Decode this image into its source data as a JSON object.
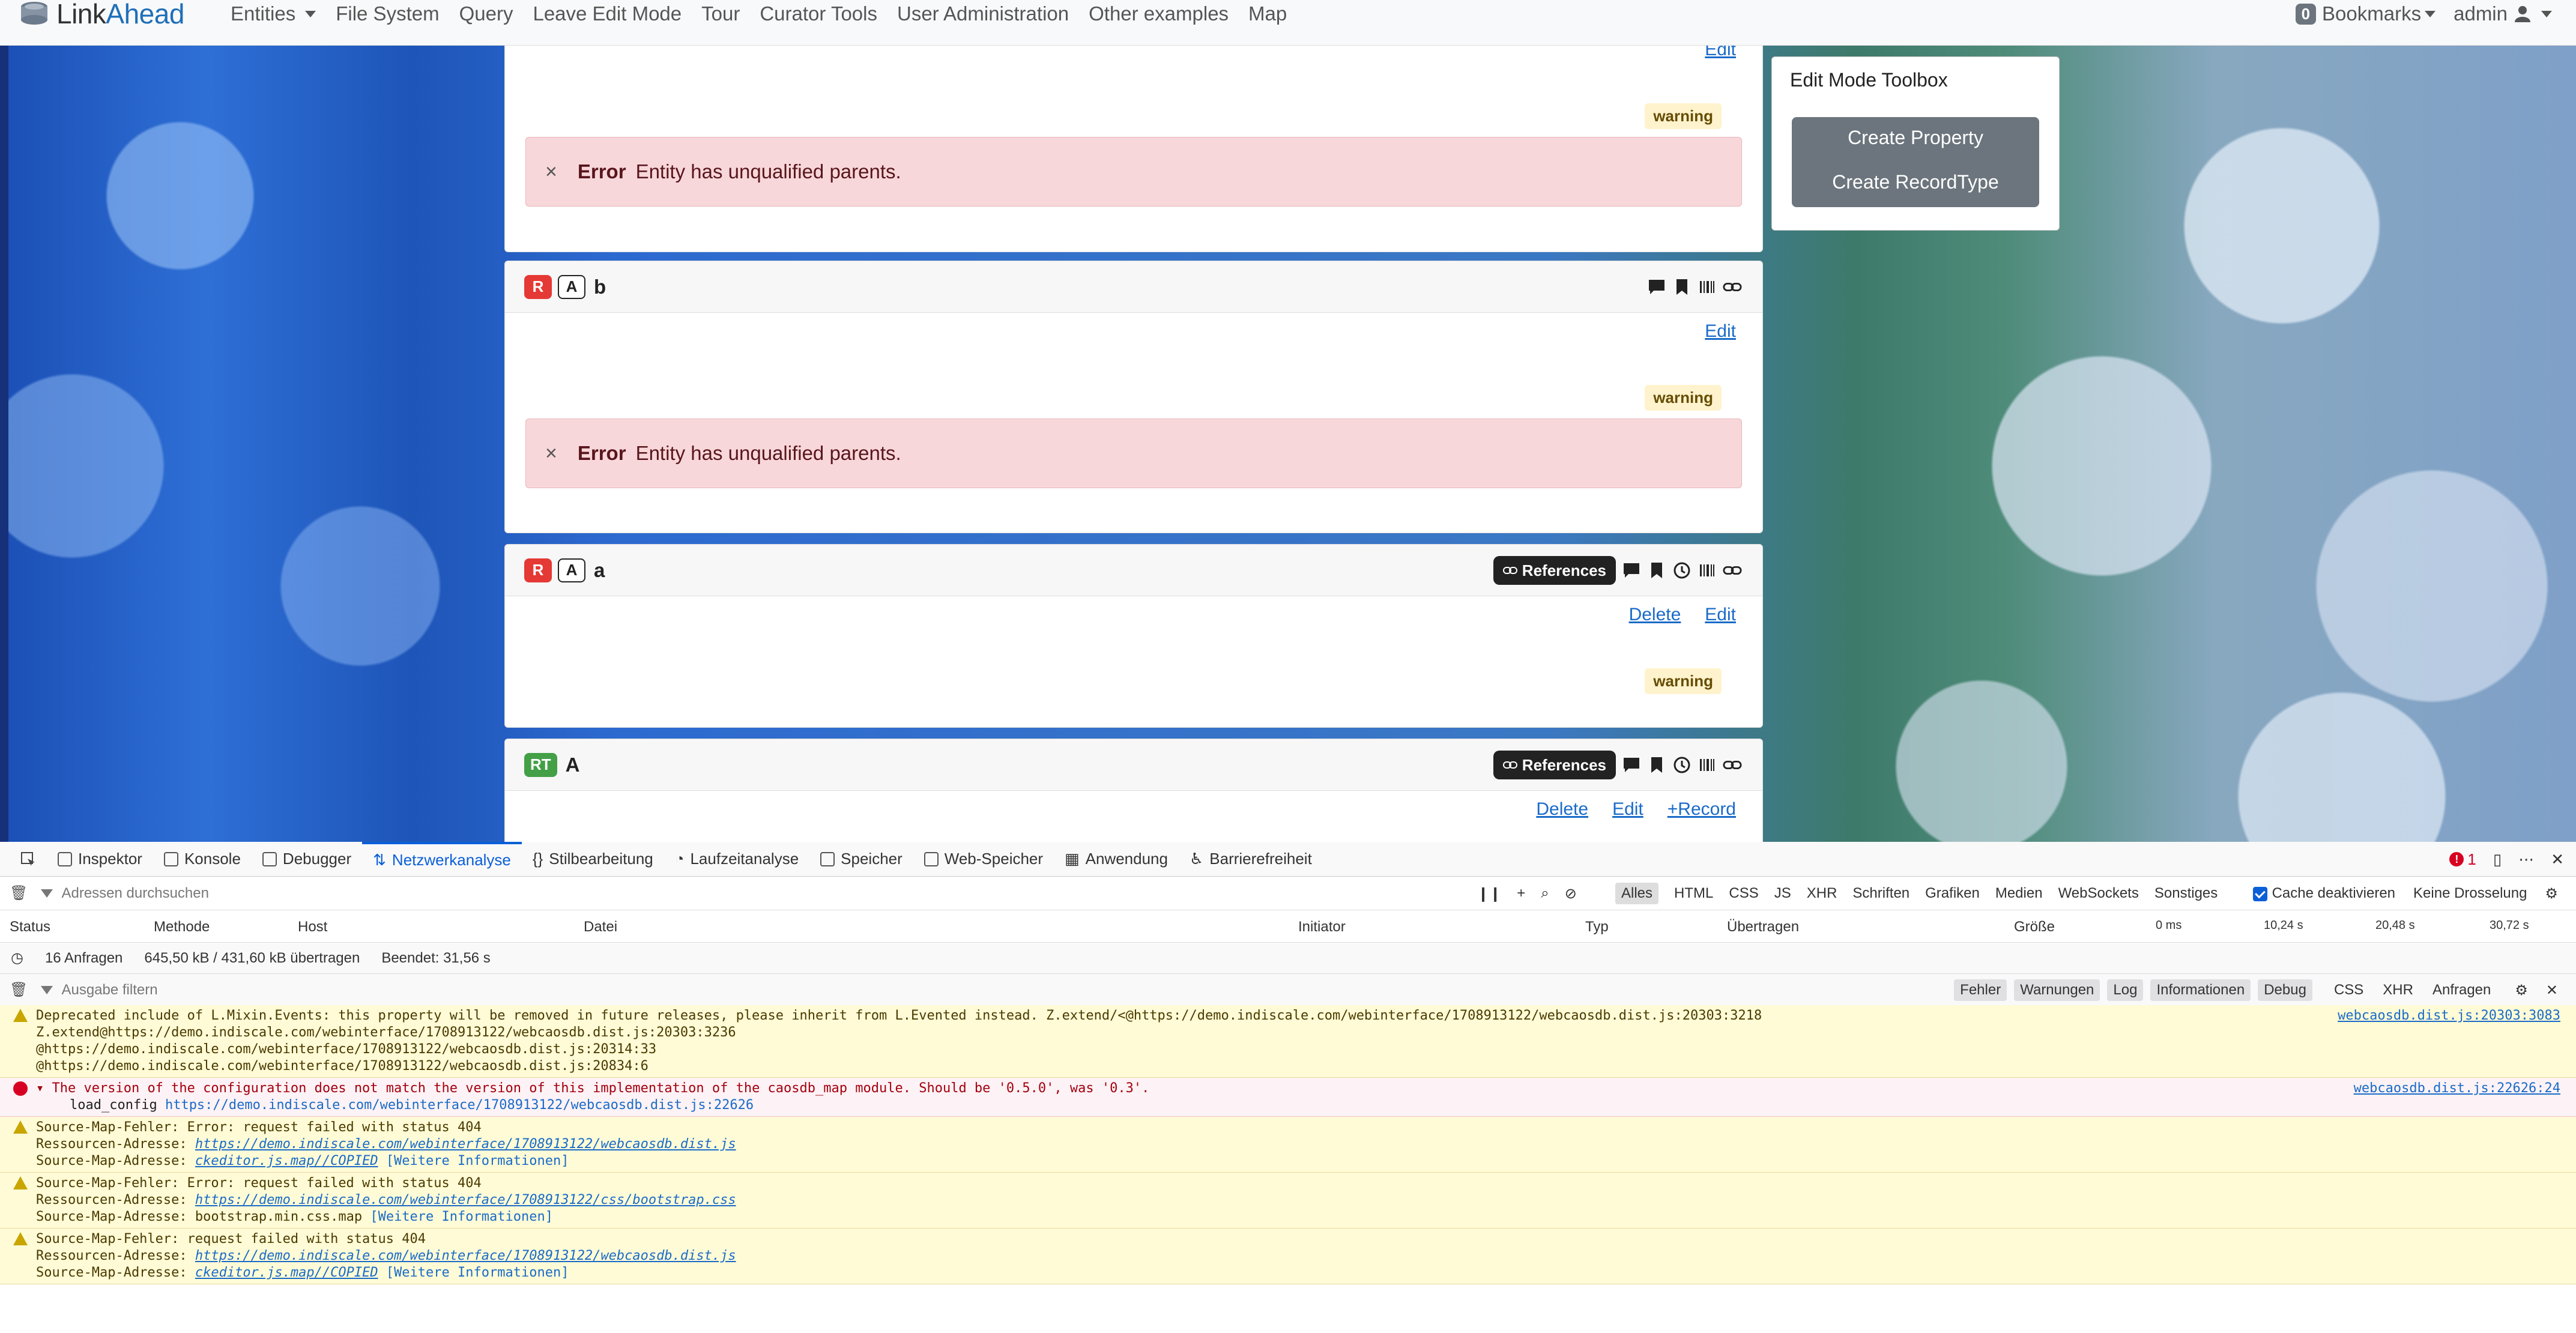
{
  "navbar": {
    "brand_prefix": "Link",
    "brand_suffix": "Ahead",
    "items": [
      "Entities",
      "File System",
      "Query",
      "Leave Edit Mode",
      "Tour",
      "Curator Tools",
      "User Administration",
      "Other examples",
      "Map"
    ],
    "bookmarks_count": "0",
    "bookmarks_label": "Bookmarks",
    "user": "admin"
  },
  "cards": [
    {
      "edit": "Edit",
      "warning": "warning",
      "error_title": "Error",
      "error_msg": "Entity has unqualified parents."
    },
    {
      "role": "R",
      "type": "A",
      "name": "b",
      "edit": "Edit",
      "warning": "warning",
      "error_title": "Error",
      "error_msg": "Entity has unqualified parents."
    },
    {
      "role": "R",
      "type": "A",
      "name": "a",
      "references": "References",
      "delete": "Delete",
      "edit": "Edit",
      "warning": "warning"
    },
    {
      "role": "RT",
      "name": "A",
      "references": "References",
      "delete": "Delete",
      "edit": "Edit",
      "add_record": "+Record"
    }
  ],
  "toolbox": {
    "title": "Edit Mode Toolbox",
    "create_property": "Create Property",
    "create_recordtype": "Create RecordType"
  },
  "devtools": {
    "tabs": [
      "Inspektor",
      "Konsole",
      "Debugger",
      "Netzwerkanalyse",
      "Stilbearbeitung",
      "Laufzeitanalyse",
      "Speicher",
      "Web-Speicher",
      "Anwendung",
      "Barrierefreiheit"
    ],
    "active_tab": "Netzwerkanalyse",
    "error_count": "1",
    "net_filter_placeholder": "Adressen durchsuchen",
    "net_types": [
      "Alles",
      "HTML",
      "CSS",
      "JS",
      "XHR",
      "Schriften",
      "Grafiken",
      "Medien",
      "WebSockets",
      "Sonstiges"
    ],
    "cache_label": "Cache deaktivieren",
    "throttle": "Keine Drosselung",
    "columns": [
      "Status",
      "Methode",
      "Host",
      "Datei",
      "Initiator",
      "Typ",
      "Übertragen",
      "Größe",
      "0 ms",
      "10,24 s",
      "20,48 s",
      "30,72 s"
    ],
    "summary": {
      "requests": "16 Anfragen",
      "transferred": "645,50 kB / 431,60 kB übertragen",
      "finished": "Beendet: 31,56 s"
    },
    "console_filter_placeholder": "Ausgabe filtern",
    "levels": [
      "Fehler",
      "Warnungen",
      "Log",
      "Informationen",
      "Debug"
    ],
    "extra_levels": [
      "CSS",
      "XHR",
      "Anfragen"
    ],
    "messages": [
      {
        "kind": "warn",
        "lines": [
          "Deprecated include of L.Mixin.Events: this property will be removed in future releases, please inherit from L.Evented instead. Z.extend/<@https://demo.indiscale.com/webinterface/1708913122/webcaosdb.dist.js:20303:3218",
          "Z.extend@https://demo.indiscale.com/webinterface/1708913122/webcaosdb.dist.js:20303:3236",
          "@https://demo.indiscale.com/webinterface/1708913122/webcaosdb.dist.js:20314:33",
          "@https://demo.indiscale.com/webinterface/1708913122/webcaosdb.dist.js:20834:6"
        ],
        "source": "webcaosdb.dist.js:20303:3083"
      },
      {
        "kind": "error",
        "line1": "The version of the configuration does not match the version of this implementation of the caosdb_map module. Should be '0.5.0', was '0.3'.",
        "fn": "load_config",
        "url": "https://demo.indiscale.com/webinterface/1708913122/webcaosdb.dist.js:22626",
        "source": "webcaosdb.dist.js:22626:24"
      },
      {
        "kind": "warn",
        "line1": "Source-Map-Fehler: Error: request failed with status 404",
        "res_label": "Ressourcen-Adresse:",
        "res_url": "https://demo.indiscale.com/webinterface/1708913122/webcaosdb.dist.js",
        "map_label": "Source-Map-Adresse:",
        "map_url": "ckeditor.js.map//COPIED",
        "more": "[Weitere Informationen]"
      },
      {
        "kind": "warn",
        "line1": "Source-Map-Fehler: Error: request failed with status 404",
        "res_label": "Ressourcen-Adresse:",
        "res_url": "https://demo.indiscale.com/webinterface/1708913122/css/bootstrap.css",
        "map_label": "Source-Map-Adresse:",
        "map_url": "bootstrap.min.css.map",
        "more": "[Weitere Informationen]"
      },
      {
        "kind": "warn",
        "line1": "Source-Map-Fehler: request failed with status 404",
        "res_label": "Ressourcen-Adresse:",
        "res_url": "https://demo.indiscale.com/webinterface/1708913122/webcaosdb.dist.js",
        "map_label": "Source-Map-Adresse:",
        "map_url": "ckeditor.js.map//COPIED",
        "more": "[Weitere Informationen]"
      }
    ]
  }
}
